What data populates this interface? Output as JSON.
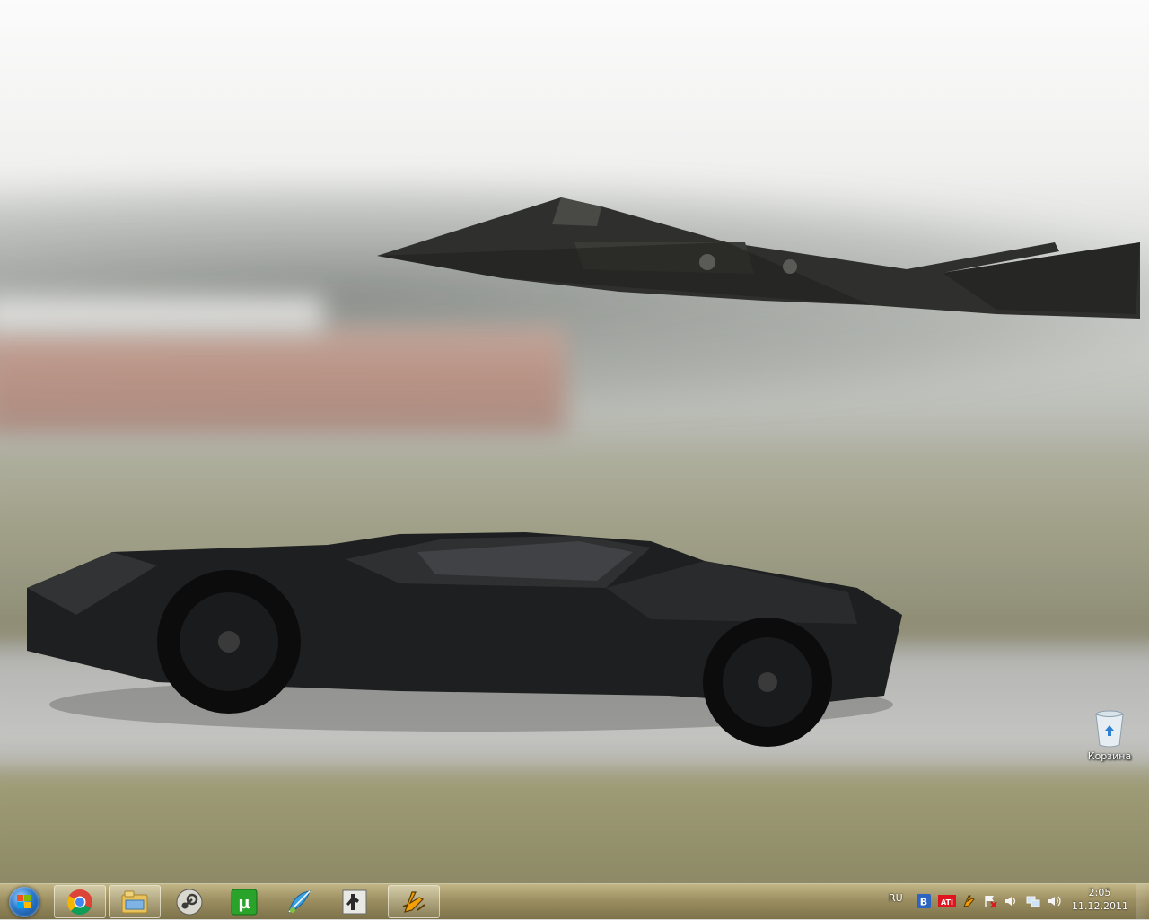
{
  "desktop": {
    "recycle_bin_label": "Корзина"
  },
  "taskbar": {
    "start_label": "",
    "pinned": [
      {
        "name": "chrome-icon"
      },
      {
        "name": "explorer-icon"
      },
      {
        "name": "steam-icon"
      },
      {
        "name": "utorrent-icon"
      },
      {
        "name": "qip-icon"
      },
      {
        "name": "counter-strike-icon"
      },
      {
        "name": "winamp-icon"
      }
    ],
    "language": "RU",
    "clock": {
      "time": "2:05",
      "date": "11.12.2011"
    },
    "colors": {
      "ati_red": "#e0141e",
      "vk_blue": "#2c64c2"
    }
  }
}
